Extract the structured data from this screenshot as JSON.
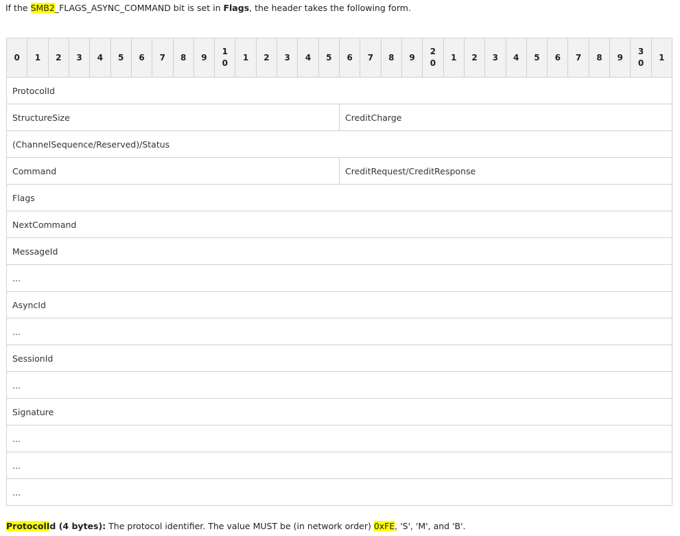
{
  "intro": {
    "prefix": "If the ",
    "highlight": "SMB2",
    "mid": "_FLAGS_ASYNC_COMMAND bit is set in ",
    "bold": "Flags",
    "suffix": ", the header takes the following form."
  },
  "bit_header": [
    [
      "0"
    ],
    [
      "1"
    ],
    [
      "2"
    ],
    [
      "3"
    ],
    [
      "4"
    ],
    [
      "5"
    ],
    [
      "6"
    ],
    [
      "7"
    ],
    [
      "8"
    ],
    [
      "9"
    ],
    [
      "1",
      "0"
    ],
    [
      "1"
    ],
    [
      "2"
    ],
    [
      "3"
    ],
    [
      "4"
    ],
    [
      "5"
    ],
    [
      "6"
    ],
    [
      "7"
    ],
    [
      "8"
    ],
    [
      "9"
    ],
    [
      "2",
      "0"
    ],
    [
      "1"
    ],
    [
      "2"
    ],
    [
      "3"
    ],
    [
      "4"
    ],
    [
      "5"
    ],
    [
      "6"
    ],
    [
      "7"
    ],
    [
      "8"
    ],
    [
      "9"
    ],
    [
      "3",
      "0"
    ],
    [
      "1"
    ]
  ],
  "rows": [
    {
      "cells": [
        {
          "label": "ProtocolId",
          "span": 32
        }
      ]
    },
    {
      "cells": [
        {
          "label": "StructureSize",
          "span": 16
        },
        {
          "label": "CreditCharge",
          "span": 16
        }
      ]
    },
    {
      "cells": [
        {
          "label": "(ChannelSequence/Reserved)/Status",
          "span": 32
        }
      ]
    },
    {
      "cells": [
        {
          "label": "Command",
          "span": 16
        },
        {
          "label": "CreditRequest/CreditResponse",
          "span": 16
        }
      ]
    },
    {
      "cells": [
        {
          "label": "Flags",
          "span": 32
        }
      ]
    },
    {
      "cells": [
        {
          "label": "NextCommand",
          "span": 32
        }
      ]
    },
    {
      "cells": [
        {
          "label": "MessageId",
          "span": 32
        }
      ]
    },
    {
      "cells": [
        {
          "label": "...",
          "span": 32
        }
      ]
    },
    {
      "cells": [
        {
          "label": "AsyncId",
          "span": 32
        }
      ]
    },
    {
      "cells": [
        {
          "label": "...",
          "span": 32
        }
      ]
    },
    {
      "cells": [
        {
          "label": "SessionId",
          "span": 32
        }
      ]
    },
    {
      "cells": [
        {
          "label": "...",
          "span": 32
        }
      ]
    },
    {
      "cells": [
        {
          "label": "Signature",
          "span": 32
        }
      ]
    },
    {
      "cells": [
        {
          "label": "...",
          "span": 32
        }
      ]
    },
    {
      "cells": [
        {
          "label": "...",
          "span": 32
        }
      ]
    },
    {
      "cells": [
        {
          "label": "...",
          "span": 32
        }
      ]
    }
  ],
  "footer": {
    "term_highlight": "ProtocolI",
    "term_rest": "d (4 bytes):",
    "text": " The protocol identifier. The value MUST be (in network order) ",
    "value_highlight": "0xFE",
    "value_rest": ", 'S', 'M', and 'B'."
  },
  "colors": {
    "highlight": "#ffff00",
    "header_bg": "#f2f2f2",
    "border": "#d0d0d0"
  }
}
